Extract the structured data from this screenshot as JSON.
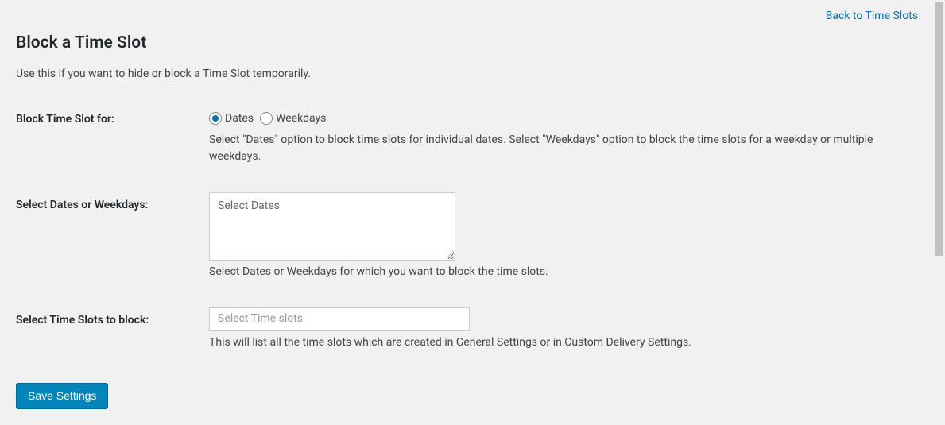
{
  "topLink": {
    "label": "Back to Time Slots"
  },
  "page": {
    "title": "Block a Time Slot",
    "description": "Use this if you want to hide or block a Time Slot temporarily."
  },
  "form": {
    "blockFor": {
      "label": "Block Time Slot for:",
      "options": {
        "dates": "Dates",
        "weekdays": "Weekdays"
      },
      "hint": "Select \"Dates\" option to block time slots for individual dates. Select \"Weekdays\" option to block the time slots for a weekday or multiple weekdays."
    },
    "selectDates": {
      "label": "Select Dates or Weekdays:",
      "placeholder": "Select Dates",
      "hint": "Select Dates or Weekdays for which you want to block the time slots."
    },
    "selectTimeSlots": {
      "label": "Select Time Slots to block:",
      "placeholder": "Select Time slots",
      "hint": "This will list all the time slots which are created in General Settings or in Custom Delivery Settings."
    },
    "submit": {
      "label": "Save Settings"
    }
  }
}
